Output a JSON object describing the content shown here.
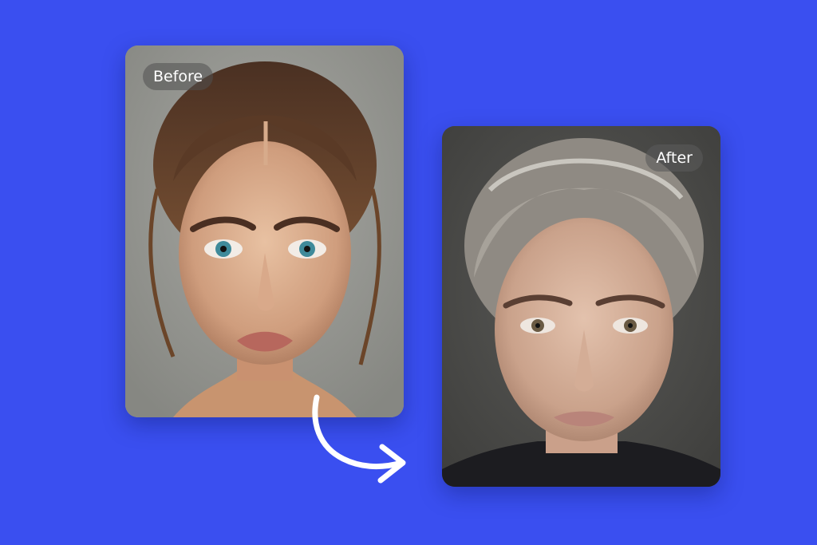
{
  "background_color": "#3a4ff0",
  "before_card": {
    "label": "Before",
    "image_alt": "portrait-young-woman"
  },
  "after_card": {
    "label": "After",
    "image_alt": "portrait-older-woman"
  },
  "transition_icon": "curved-arrow-icon"
}
